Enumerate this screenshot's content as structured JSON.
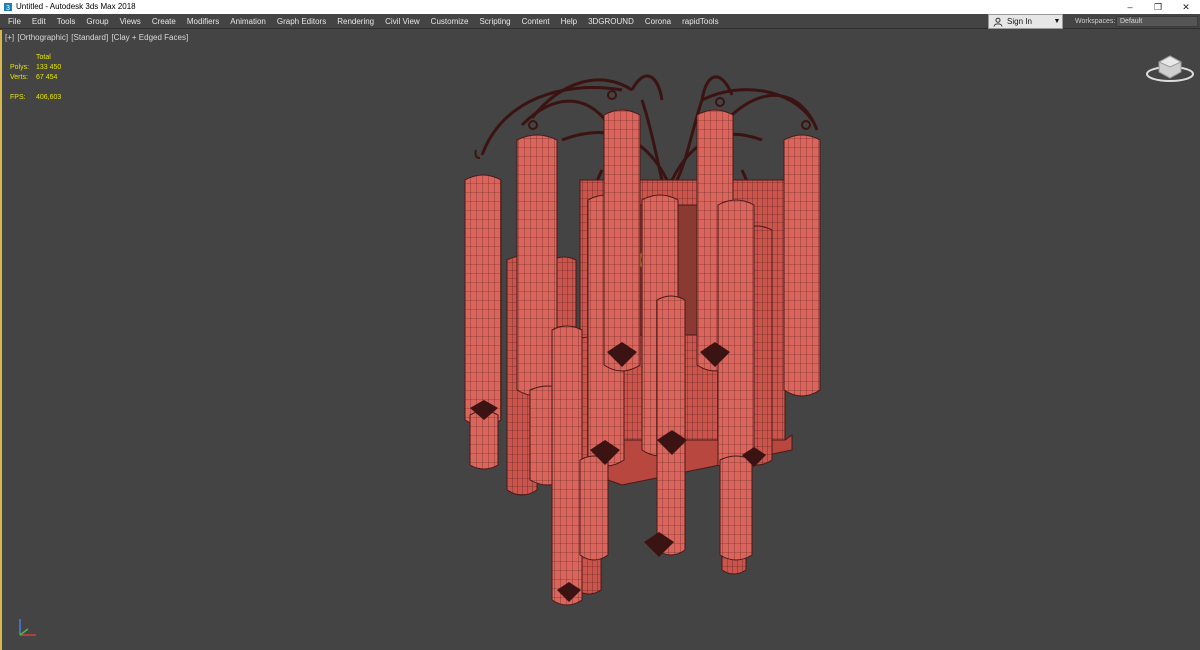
{
  "window": {
    "title": "Untitled - Autodesk 3ds Max 2018"
  },
  "menu": [
    "File",
    "Edit",
    "Tools",
    "Group",
    "Views",
    "Create",
    "Modifiers",
    "Animation",
    "Graph Editors",
    "Rendering",
    "Civil View",
    "Customize",
    "Scripting",
    "Content",
    "Help",
    "3DGROUND",
    "Corona",
    "rapidTools"
  ],
  "account": {
    "sign_in": "Sign In"
  },
  "workspace": {
    "label": "Workspaces:",
    "value": "Default"
  },
  "viewport": {
    "label_plus": "[+]",
    "label_view": "[Orthographic]",
    "label_shading": "[Standard]",
    "label_mode": "[Clay + Edged Faces]",
    "stats": {
      "header": "Total",
      "polys_label": "Polys:",
      "polys_value": "133 450",
      "verts_label": "Verts:",
      "verts_value": "67 454",
      "fps_label": "FPS:",
      "fps_value": "406,603"
    }
  },
  "colors": {
    "model_fill": "#d9655c",
    "model_wire": "#5a1f1c",
    "arm_color": "#3a1312",
    "stats_color": "#e4e400",
    "active_border": "#d9b64a"
  }
}
